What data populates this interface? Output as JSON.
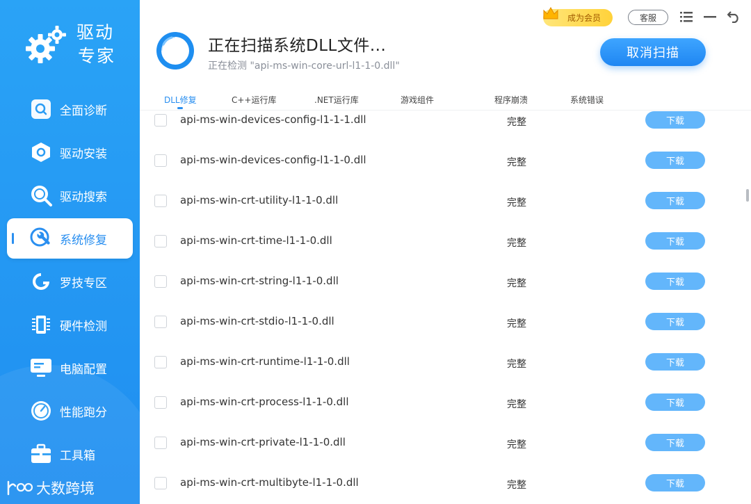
{
  "app": {
    "brand_name": "驱动\n专家",
    "brand_line1": "驱动",
    "brand_line2": "专家"
  },
  "sidebar": {
    "items": [
      {
        "label": "全面诊断",
        "icon": "diagnosis-icon",
        "active": false
      },
      {
        "label": "驱动安装",
        "icon": "driver-install-icon",
        "active": false
      },
      {
        "label": "驱动搜索",
        "icon": "search-icon",
        "active": false
      },
      {
        "label": "系统修复",
        "icon": "repair-wrench-icon",
        "active": true
      },
      {
        "label": "罗技专区",
        "icon": "logitech-icon",
        "active": false
      },
      {
        "label": "硬件检测",
        "icon": "hardware-chip-icon",
        "active": false
      },
      {
        "label": "电脑配置",
        "icon": "monitor-icon",
        "active": false
      },
      {
        "label": "性能跑分",
        "icon": "gauge-icon",
        "active": false
      },
      {
        "label": "工具箱",
        "icon": "toolbox-icon",
        "active": false
      }
    ],
    "watermark": "大数跨境"
  },
  "header": {
    "scan_title": "正在扫描系统DLL文件...",
    "scan_sub": "正在检测 \"api-ms-win-core-url-l1-1-0.dll\"",
    "vip_label": "成为会员",
    "service_label": "客服",
    "cancel_label": "取消扫描"
  },
  "tabs": [
    {
      "label": "DLL修复",
      "active": true
    },
    {
      "label": "C++运行库",
      "active": false
    },
    {
      "label": ".NET运行库",
      "active": false
    },
    {
      "label": "游戏组件",
      "active": false
    },
    {
      "label": "程序崩溃",
      "active": false
    },
    {
      "label": "系统错误",
      "active": false
    }
  ],
  "rows": [
    {
      "file": "api-ms-win-devices-config-l1-1-1.dll",
      "status": "完整",
      "action": "下载"
    },
    {
      "file": "api-ms-win-devices-config-l1-1-0.dll",
      "status": "完整",
      "action": "下载"
    },
    {
      "file": "api-ms-win-crt-utility-l1-1-0.dll",
      "status": "完整",
      "action": "下载"
    },
    {
      "file": "api-ms-win-crt-time-l1-1-0.dll",
      "status": "完整",
      "action": "下载"
    },
    {
      "file": "api-ms-win-crt-string-l1-1-0.dll",
      "status": "完整",
      "action": "下载"
    },
    {
      "file": "api-ms-win-crt-stdio-l1-1-0.dll",
      "status": "完整",
      "action": "下载"
    },
    {
      "file": "api-ms-win-crt-runtime-l1-1-0.dll",
      "status": "完整",
      "action": "下载"
    },
    {
      "file": "api-ms-win-crt-process-l1-1-0.dll",
      "status": "完整",
      "action": "下载"
    },
    {
      "file": "api-ms-win-crt-private-l1-1-0.dll",
      "status": "完整",
      "action": "下载"
    },
    {
      "file": "api-ms-win-crt-multibyte-l1-1-0.dll",
      "status": "完整",
      "action": "下载"
    }
  ],
  "colors": {
    "accent": "#2a8ff0",
    "sidebar": "#2aa3f6",
    "download_button": "#63b6fb",
    "vip_gold": "#ffd23a"
  }
}
